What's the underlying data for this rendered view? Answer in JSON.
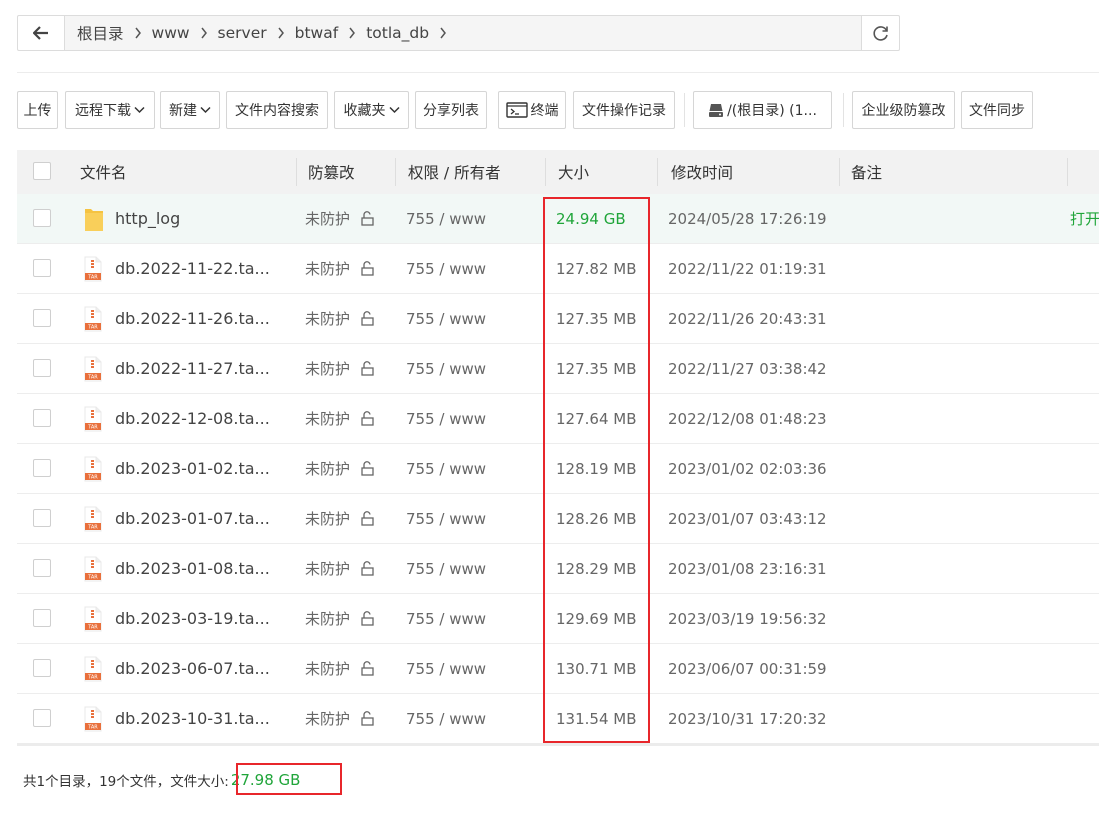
{
  "breadcrumb": [
    "根目录",
    "www",
    "server",
    "btwaf",
    "totla_db"
  ],
  "toolbar": {
    "upload": "上传",
    "remote_download": "远程下载",
    "new": "新建",
    "content_search": "文件内容搜索",
    "favorites": "收藏夹",
    "share_list": "分享列表",
    "terminal": "终端",
    "op_log": "文件操作记录",
    "disk": "/(根目录) (1...",
    "tamper": "企业级防篡改",
    "sync": "文件同步"
  },
  "table": {
    "headers": {
      "name": "文件名",
      "tamper": "防篡改",
      "perm": "权限 / 所有者",
      "size": "大小",
      "mtime": "修改时间",
      "note": "备注"
    },
    "rows": [
      {
        "name": "http_log",
        "type": "folder",
        "tamper": "未防护",
        "perm": "755 / www",
        "size": "24.94 GB",
        "mtime": "2024/05/28 17:26:19",
        "action": "打开"
      },
      {
        "name": "db.2022-11-22.ta...",
        "type": "tar",
        "tamper": "未防护",
        "perm": "755 / www",
        "size": "127.82 MB",
        "mtime": "2022/11/22 01:19:31"
      },
      {
        "name": "db.2022-11-26.ta...",
        "type": "tar",
        "tamper": "未防护",
        "perm": "755 / www",
        "size": "127.35 MB",
        "mtime": "2022/11/26 20:43:31"
      },
      {
        "name": "db.2022-11-27.ta...",
        "type": "tar",
        "tamper": "未防护",
        "perm": "755 / www",
        "size": "127.35 MB",
        "mtime": "2022/11/27 03:38:42"
      },
      {
        "name": "db.2022-12-08.ta...",
        "type": "tar",
        "tamper": "未防护",
        "perm": "755 / www",
        "size": "127.64 MB",
        "mtime": "2022/12/08 01:48:23"
      },
      {
        "name": "db.2023-01-02.ta...",
        "type": "tar",
        "tamper": "未防护",
        "perm": "755 / www",
        "size": "128.19 MB",
        "mtime": "2023/01/02 02:03:36"
      },
      {
        "name": "db.2023-01-07.ta...",
        "type": "tar",
        "tamper": "未防护",
        "perm": "755 / www",
        "size": "128.26 MB",
        "mtime": "2023/01/07 03:43:12"
      },
      {
        "name": "db.2023-01-08.ta...",
        "type": "tar",
        "tamper": "未防护",
        "perm": "755 / www",
        "size": "128.29 MB",
        "mtime": "2023/01/08 23:16:31"
      },
      {
        "name": "db.2023-03-19.ta...",
        "type": "tar",
        "tamper": "未防护",
        "perm": "755 / www",
        "size": "129.69 MB",
        "mtime": "2023/03/19 19:56:32"
      },
      {
        "name": "db.2023-06-07.ta...",
        "type": "tar",
        "tamper": "未防护",
        "perm": "755 / www",
        "size": "130.71 MB",
        "mtime": "2023/06/07 00:31:59"
      },
      {
        "name": "db.2023-10-31.ta...",
        "type": "tar",
        "tamper": "未防护",
        "perm": "755 / www",
        "size": "131.54 MB",
        "mtime": "2023/10/31 17:20:32"
      }
    ]
  },
  "footer": {
    "summary": "共1个目录，19个文件，文件大小:",
    "total": "27.98 GB"
  },
  "colors": {
    "accent_green": "#20a53a",
    "highlight_red": "#e8262b"
  }
}
